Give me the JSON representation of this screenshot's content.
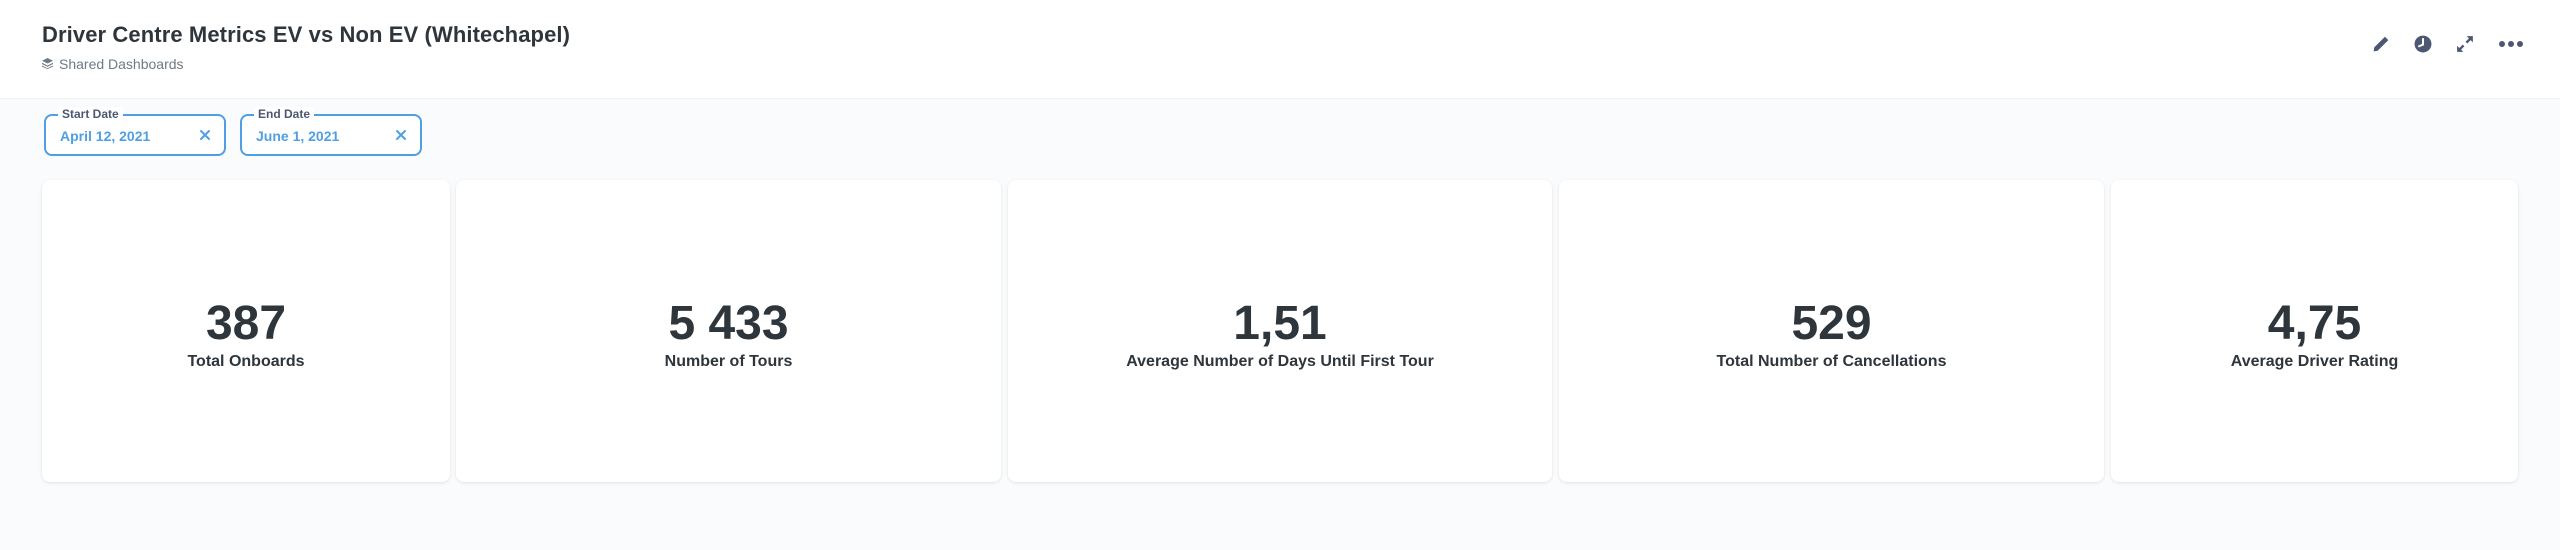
{
  "dashboard": {
    "title": "Driver Centre Metrics EV vs Non EV (Whitechapel)",
    "collection": "Shared Dashboards",
    "collection_icon": "collection-icon"
  },
  "header_actions": [
    {
      "name": "edit-icon"
    },
    {
      "name": "history-icon"
    },
    {
      "name": "fullscreen-icon"
    },
    {
      "name": "more-options-icon"
    }
  ],
  "filters": {
    "start": {
      "label": "Start Date",
      "value": "April 12, 2021"
    },
    "end": {
      "label": "End Date",
      "value": "June 1, 2021"
    }
  },
  "cards": [
    {
      "value": "387",
      "label": "Total Onboards"
    },
    {
      "value": "5 433",
      "label": "Number of Tours"
    },
    {
      "value": "1,51",
      "label": "Average Number of Days Until First Tour"
    },
    {
      "value": "529",
      "label": "Total Number of Cancellations"
    },
    {
      "value": "4,75",
      "label": "Average Driver Rating"
    }
  ],
  "colors": {
    "accent": "#509ee3",
    "text": "#2e353b",
    "muted": "#6e7a86",
    "background": "#f9fbfc"
  }
}
